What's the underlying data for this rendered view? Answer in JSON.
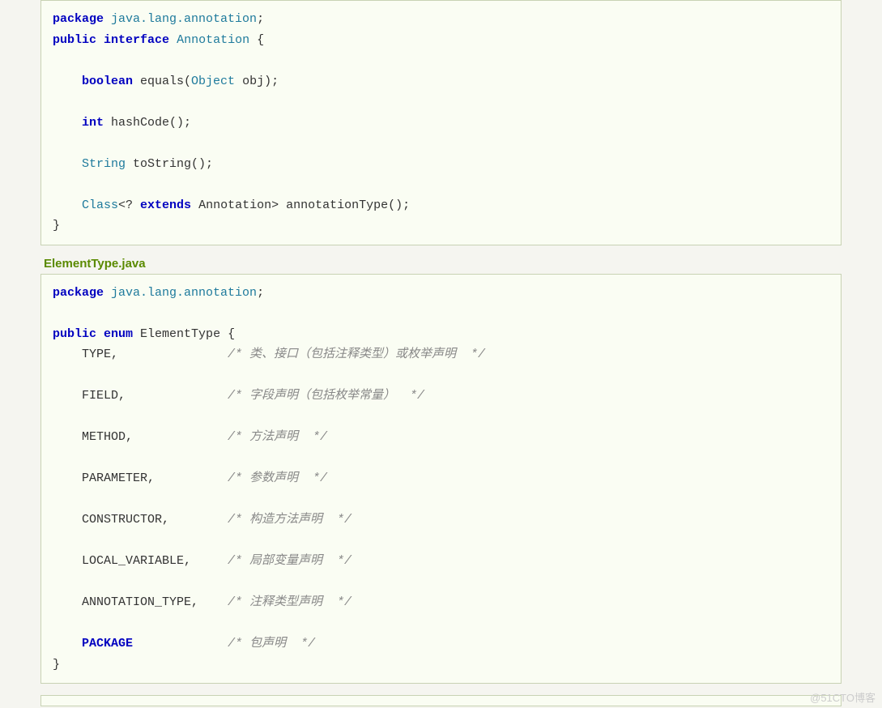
{
  "block1": {
    "t": [
      {
        "type": "kw",
        "text": "package"
      },
      {
        "type": "plain",
        "text": " "
      },
      {
        "type": "pkg",
        "text": "java.lang.annotation"
      },
      {
        "type": "plain",
        "text": ";"
      }
    ],
    "l2": [
      {
        "type": "kw",
        "text": "public"
      },
      {
        "type": "plain",
        "text": " "
      },
      {
        "type": "kw",
        "text": "interface"
      },
      {
        "type": "plain",
        "text": " "
      },
      {
        "type": "type",
        "text": "Annotation"
      },
      {
        "type": "plain",
        "text": " {"
      }
    ],
    "l3": [
      {
        "type": "plain",
        "text": "    "
      },
      {
        "type": "kw",
        "text": "boolean"
      },
      {
        "type": "plain",
        "text": " equals("
      },
      {
        "type": "type",
        "text": "Object"
      },
      {
        "type": "plain",
        "text": " obj);"
      }
    ],
    "l4": [
      {
        "type": "plain",
        "text": "    "
      },
      {
        "type": "kw",
        "text": "int"
      },
      {
        "type": "plain",
        "text": " hashCode();"
      }
    ],
    "l5": [
      {
        "type": "plain",
        "text": "    "
      },
      {
        "type": "type",
        "text": "String"
      },
      {
        "type": "plain",
        "text": " toString();"
      }
    ],
    "l6": [
      {
        "type": "plain",
        "text": "    "
      },
      {
        "type": "type",
        "text": "Class"
      },
      {
        "type": "plain",
        "text": "<? "
      },
      {
        "type": "kw",
        "text": "extends"
      },
      {
        "type": "plain",
        "text": " Annotation> annotationType();"
      }
    ],
    "l7": [
      {
        "type": "plain",
        "text": "}"
      }
    ]
  },
  "section2_title": "ElementType.java",
  "block2": {
    "t": [
      {
        "type": "kw",
        "text": "package"
      },
      {
        "type": "plain",
        "text": " "
      },
      {
        "type": "pkg",
        "text": "java.lang.annotation"
      },
      {
        "type": "plain",
        "text": ";"
      }
    ],
    "l2": [
      {
        "type": "kw",
        "text": "public"
      },
      {
        "type": "plain",
        "text": " "
      },
      {
        "type": "kw",
        "text": "enum"
      },
      {
        "type": "plain",
        "text": " ElementType {"
      }
    ],
    "rows": [
      {
        "name": "TYPE,",
        "pad": "               ",
        "comment": "/* 类、接口（包括注释类型）或枚举声明  */"
      },
      {
        "name": "FIELD,",
        "pad": "              ",
        "comment": "/* 字段声明（包括枚举常量）  */"
      },
      {
        "name": "METHOD,",
        "pad": "             ",
        "comment": "/* 方法声明  */"
      },
      {
        "name": "PARAMETER,",
        "pad": "          ",
        "comment": "/* 参数声明  */"
      },
      {
        "name": "CONSTRUCTOR,",
        "pad": "        ",
        "comment": "/* 构造方法声明  */"
      },
      {
        "name": "LOCAL_VARIABLE,",
        "pad": "     ",
        "comment": "/* 局部变量声明  */"
      },
      {
        "name": "ANNOTATION_TYPE,",
        "pad": "    ",
        "comment": "/* 注释类型声明  */"
      },
      {
        "name": "PACKAGE",
        "pad": "             ",
        "comment": "/* 包声明  */",
        "bold": true
      }
    ],
    "close": "}"
  },
  "watermark": "@51CTO博客"
}
